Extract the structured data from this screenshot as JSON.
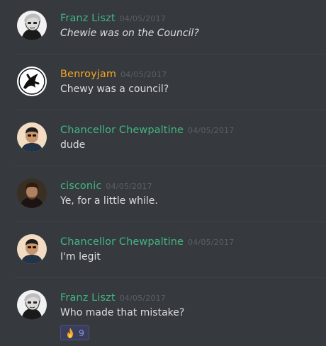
{
  "colors": {
    "background": "#36393e",
    "green_role": "#43b581",
    "gold_role": "#f5a623",
    "timestamp": "#5c5f63",
    "text": "#dcddde"
  },
  "messages": [
    {
      "author": "Franz Liszt",
      "timestamp": "04/05/2017",
      "text": "Chewie was on the Council?",
      "italic": true,
      "avatar": "liszt-avatar"
    },
    {
      "author": "Benroyjam",
      "timestamp": "04/05/2017",
      "text": "Chewy was a council?",
      "avatar": "benroyjam-avatar"
    },
    {
      "author": "Chancellor Chewpaltine",
      "timestamp": "04/05/2017",
      "text": "dude",
      "avatar": "chewpaltine-avatar"
    },
    {
      "author": "cisconic",
      "timestamp": "04/05/2017",
      "text": "Ye, for a little while.",
      "avatar": "cisconic-avatar"
    },
    {
      "author": "Chancellor Chewpaltine",
      "timestamp": "04/05/2017",
      "text": "I'm legit",
      "avatar": "chewpaltine-avatar"
    },
    {
      "author": "Franz Liszt",
      "timestamp": "04/05/2017",
      "text": "Who made that mistake?",
      "avatar": "liszt-avatar",
      "reaction": {
        "emoji": "fire-icon",
        "count": "9"
      }
    }
  ]
}
